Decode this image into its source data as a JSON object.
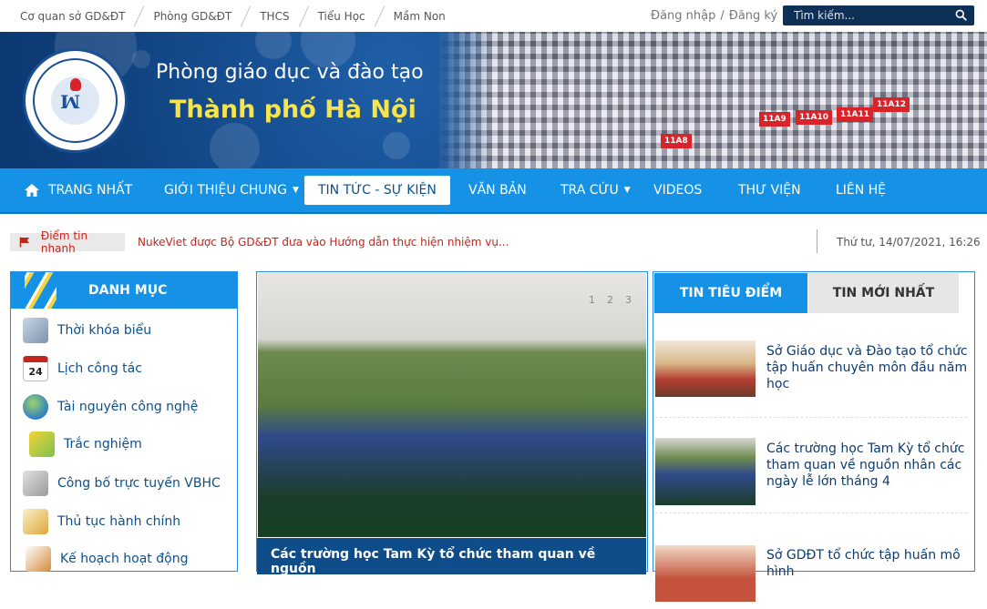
{
  "topbar": {
    "links": [
      "Cơ quan sở GD&ĐT",
      "Phòng GD&ĐT",
      "THCS",
      "Tiểu Học",
      "Mầm Non"
    ],
    "login": "Đăng nhập",
    "slash": "/",
    "register": "Đăng ký",
    "search_placeholder": "Tìm kiếm..."
  },
  "header": {
    "title_line1": "Phòng giáo dục và đào tạo",
    "title_line2": "Thành phố Hà Nội",
    "photo_signs": [
      "11A8",
      "11A9",
      "11A10",
      "11A11",
      "11A12"
    ]
  },
  "nav": {
    "items": [
      "TRANG NHẤT",
      "GIỚI THIỆU CHUNG",
      "TIN TỨC - SỰ KIỆN",
      "VĂN BẢN",
      "TRA CỨU",
      "VIDEOS",
      "THƯ VIỆN",
      "LIÊN HỆ"
    ],
    "active": "TIN TỨC - SỰ KIỆN"
  },
  "ticker": {
    "label": "Điểm tin nhanh",
    "text": "NukeViet được Bộ GD&ĐT đưa vào Hướng dẫn thực hiện nhiệm vụ...",
    "datetime": "Thứ tư, 14/07/2021, 16:26"
  },
  "menu": {
    "title": "DANH MỤC",
    "items": [
      "Thời khóa biểu",
      "Lịch công tác",
      "Tài nguyên công nghệ",
      "Trắc nghiệm",
      "Công bố trực tuyến VBHC",
      "Thủ tục hành chính",
      "Kế hoạch hoạt động"
    ],
    "calendar_day": "24"
  },
  "slider": {
    "pages": [
      "1",
      "2",
      "3"
    ],
    "caption": "Các trường học Tam Kỳ tổ chức tham quan về nguồn"
  },
  "news": {
    "tabs": [
      "TIN TIÊU ĐIỂM",
      "TIN MỚI NHẤT"
    ],
    "items": [
      "Sở Giáo dục và Đào tạo tổ chức tập huấn chuyên môn đầu năm học",
      "Các trường học Tam Kỳ tổ chức tham quan về nguồn nhân các ngày lễ lớn tháng 4",
      "Sở GDĐT tổ chức tập huấn mô hình"
    ]
  },
  "colors": {
    "nav_blue": "#1591e6",
    "dark_navy": "#0e2f56",
    "ticker_red": "#c2261d",
    "title_yellow": "#f6e44a"
  }
}
